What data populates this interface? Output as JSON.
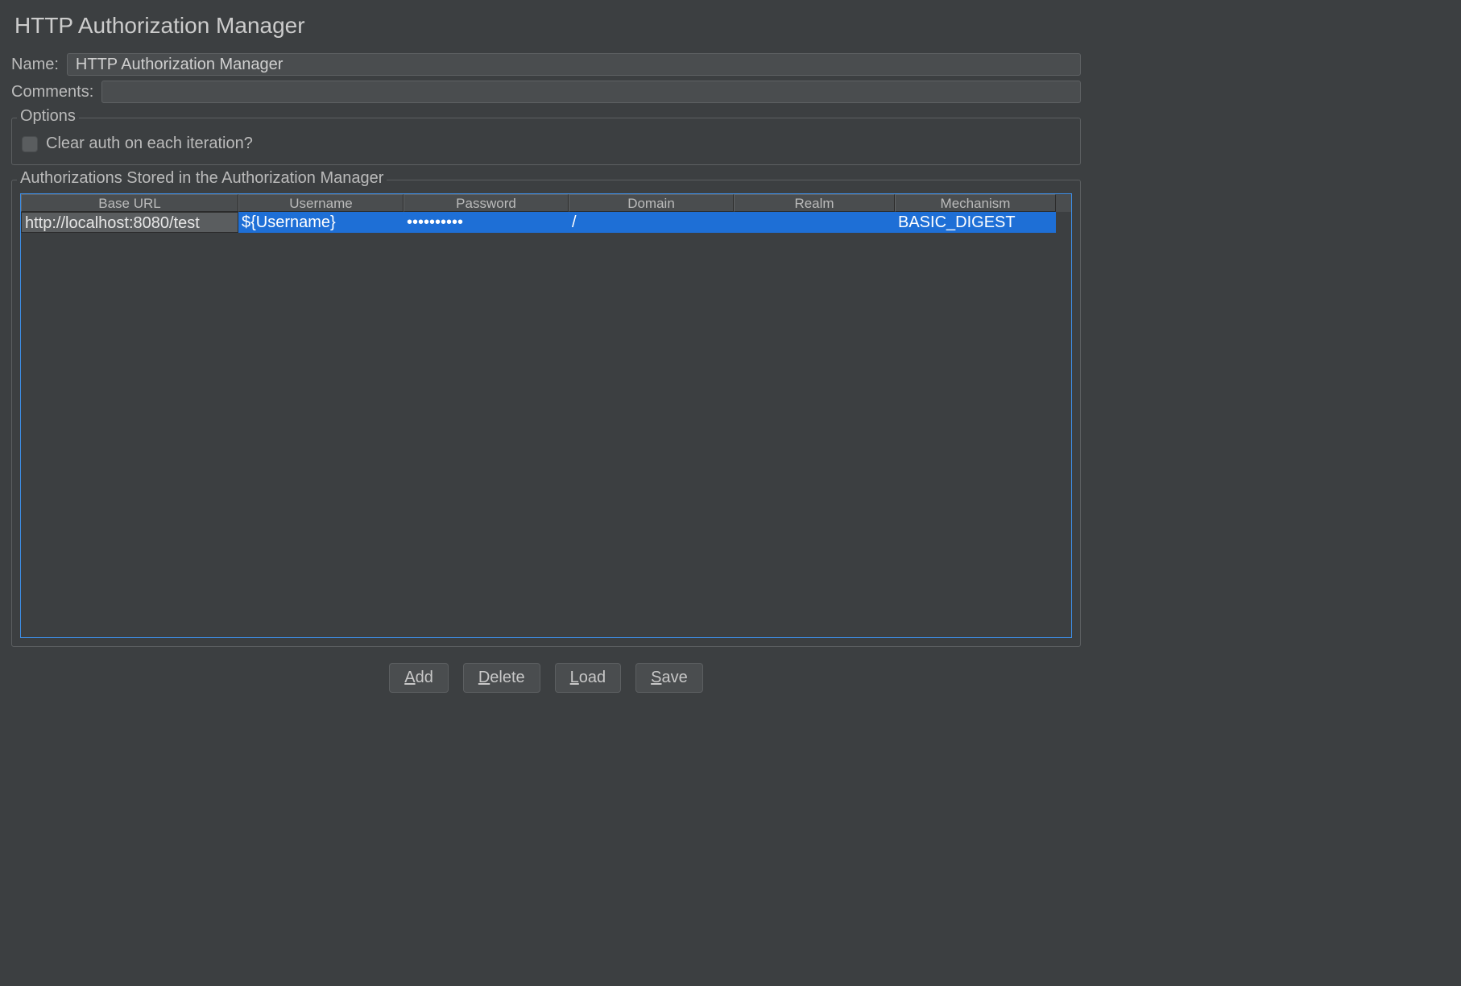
{
  "title": "HTTP Authorization Manager",
  "form": {
    "name_label": "Name:",
    "name_value": "HTTP Authorization Manager",
    "comments_label": "Comments:",
    "comments_value": ""
  },
  "options": {
    "legend": "Options",
    "clear_auth_label": "Clear auth on each iteration?",
    "clear_auth_checked": false
  },
  "auth": {
    "legend": "Authorizations Stored in the Authorization Manager",
    "columns": [
      "Base URL",
      "Username",
      "Password",
      "Domain",
      "Realm",
      "Mechanism"
    ],
    "rows": [
      {
        "base_url": "http://localhost:8080/test",
        "username": "${Username}",
        "password": "••••••••••",
        "domain": "/",
        "realm": "",
        "mechanism": "BASIC_DIGEST",
        "editing_col": 0,
        "selected": true
      }
    ]
  },
  "buttons": {
    "add": "Add",
    "delete": "Delete",
    "load": "Load",
    "save": "Save"
  }
}
